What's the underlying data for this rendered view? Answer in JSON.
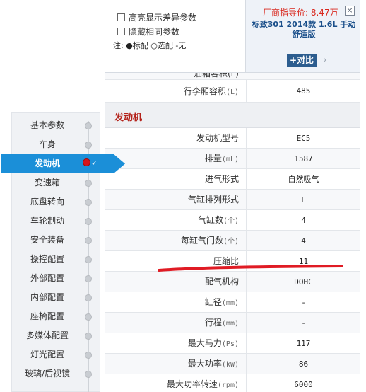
{
  "filter": {
    "highlight_diff": "高亮显示差异参数",
    "hide_same": "隐藏相同参数",
    "legend": "注: ●标配 ○选配 -无"
  },
  "car": {
    "price": "厂商指导价: 8.47万",
    "close": "×",
    "name": "标致301 2014款 1.6L 手动舒适版",
    "compare_label": "+对比",
    "compare_arrow": "›"
  },
  "cut_row": {
    "label": "油箱容积(L)",
    "value": "--"
  },
  "spec_above": {
    "label": "行李厢容积",
    "unit": "(L)",
    "value": "485"
  },
  "section": {
    "title": "发动机"
  },
  "rows": [
    {
      "label": "发动机型号",
      "unit": "",
      "value": "EC5"
    },
    {
      "label": "排量",
      "unit": "(mL)",
      "value": "1587"
    },
    {
      "label": "进气形式",
      "unit": "",
      "value": "自然吸气"
    },
    {
      "label": "气缸排列形式",
      "unit": "",
      "value": "L"
    },
    {
      "label": "气缸数",
      "unit": "(个)",
      "value": "4"
    },
    {
      "label": "每缸气门数",
      "unit": "(个)",
      "value": "4"
    },
    {
      "label": "压缩比",
      "unit": "",
      "value": "11"
    },
    {
      "label": "配气机构",
      "unit": "",
      "value": "DOHC"
    },
    {
      "label": "缸径",
      "unit": "(mm)",
      "value": "-"
    },
    {
      "label": "行程",
      "unit": "(mm)",
      "value": "-"
    },
    {
      "label": "最大马力",
      "unit": "(Ps)",
      "value": "117"
    },
    {
      "label": "最大功率",
      "unit": "(kW)",
      "value": "86"
    },
    {
      "label": "最大功率转速",
      "unit": "(rpm)",
      "value": "6000"
    }
  ],
  "nav": [
    {
      "label": "基本参数"
    },
    {
      "label": "车身"
    },
    {
      "label": "发动机",
      "active": true
    },
    {
      "label": "变速箱"
    },
    {
      "label": "底盘转向"
    },
    {
      "label": "车轮制动"
    },
    {
      "label": "安全装备"
    },
    {
      "label": "操控配置"
    },
    {
      "label": "外部配置"
    },
    {
      "label": "内部配置"
    },
    {
      "label": "座椅配置"
    },
    {
      "label": "多媒体配置"
    },
    {
      "label": "灯光配置"
    },
    {
      "label": "玻璃/后视镜"
    }
  ],
  "colors": {
    "accent": "#1b8fd8",
    "section_title": "#b4231b",
    "price": "#d9281e",
    "markup": "#e01b24"
  }
}
